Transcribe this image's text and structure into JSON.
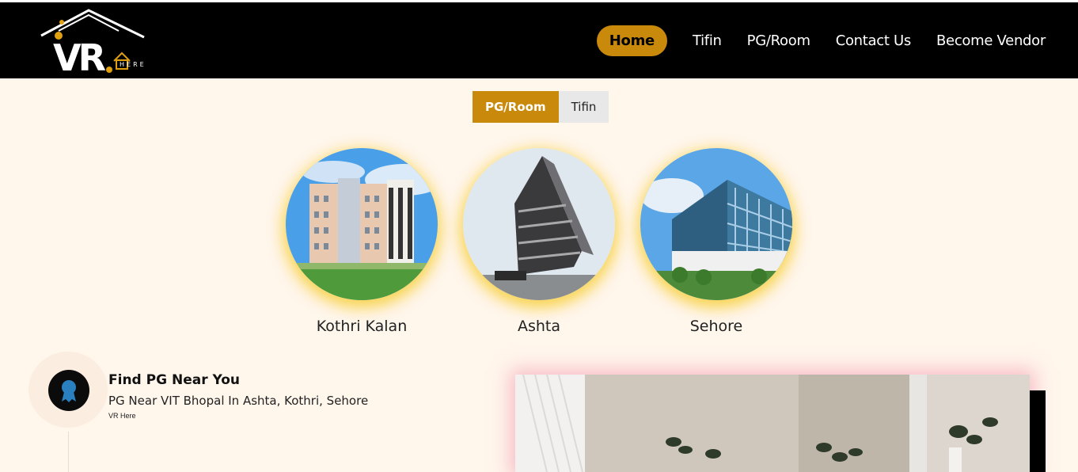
{
  "brand": {
    "logo_text": "VR",
    "logo_sub": "HERE"
  },
  "nav": {
    "items": [
      {
        "label": "Home",
        "active": true
      },
      {
        "label": "Tifin",
        "active": false
      },
      {
        "label": "PG/Room",
        "active": false
      },
      {
        "label": "Contact Us",
        "active": false
      },
      {
        "label": "Become Vendor",
        "active": false
      }
    ]
  },
  "toggle": {
    "options": [
      {
        "label": "PG/Room",
        "active": true
      },
      {
        "label": "Tifin",
        "active": false
      }
    ]
  },
  "locations": [
    {
      "label": "Kothri Kalan"
    },
    {
      "label": "Ashta"
    },
    {
      "label": "Sehore"
    }
  ],
  "find": {
    "title": "Find PG Near You",
    "subtitle": "PG Near VIT Bhopal In Ashta, Kothri, Sehore",
    "small": "VR Here"
  },
  "colors": {
    "accent": "#c98a0b",
    "navbar_bg": "#000000",
    "page_bg": "#fff6ec",
    "glow": "#f5c81e"
  }
}
